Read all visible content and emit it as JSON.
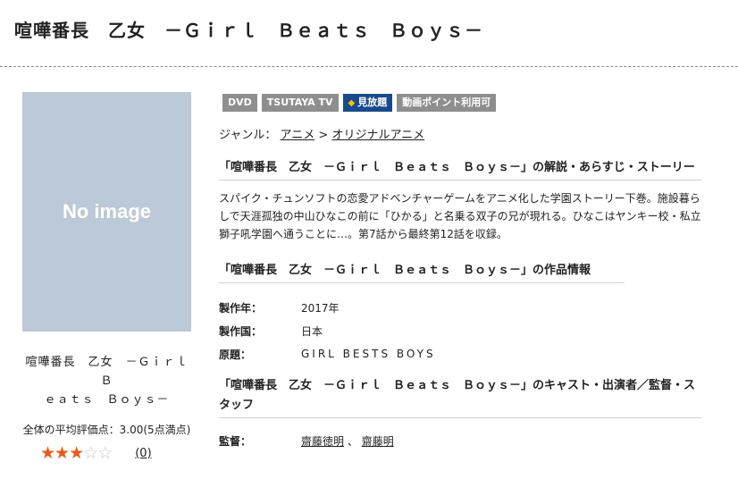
{
  "page": {
    "title": "喧嘩番長　乙女　－Ｇｉｒｌ　Ｂｅａｔｓ　Ｂｏｙｓ－"
  },
  "thumbnail": {
    "placeholder_text": "No image"
  },
  "sidebar": {
    "title_line1": "喧嘩番長　乙女　－Ｇｉｒｌ　Ｂ",
    "title_line2": "ｅａｔｓ　Ｂｏｙｓ－",
    "avg_rating_text": "全体の平均評価点：3.00(5点満点)",
    "stars_filled": 3,
    "stars_total": 5,
    "review_count": "(0)"
  },
  "badges": [
    {
      "label": "DVD",
      "icon": "none",
      "color": "#8e8e8e"
    },
    {
      "label": "TSUTAYA TV",
      "icon": "none",
      "color": "#8e8e8e"
    },
    {
      "label": "見放題",
      "icon": "t-logo-icon",
      "color": "#1a4a8c"
    },
    {
      "label": "動画ポイント利用可",
      "icon": "none",
      "color": "#8e8e8e"
    }
  ],
  "genre": {
    "label": "ジャンル：",
    "item1": "アニメ",
    "separator": ">",
    "item2": "オリジナルアニメ"
  },
  "synopsis": {
    "heading": "「喧嘩番長　乙女　－Ｇｉｒｌ　Ｂｅａｔｓ　Ｂｏｙｓ－」の解説・あらすじ・ストーリー",
    "text": "スパイク・チュンソフトの恋愛アドベンチャーゲームをアニメ化した学園ストーリー下巻。施設暮らしで天涯孤独の中山ひなこの前に「ひかる」と名乗る双子の兄が現れる。ひなこはヤンキー校・私立獅子吼学園へ通うことに…。第7話から最終第12話を収録。"
  },
  "work_info": {
    "heading": "「喧嘩番長　乙女　－Ｇｉｒｌ　Ｂｅａｔｓ　Ｂｏｙｓ－」の作品情報",
    "rows": [
      {
        "label": "製作年：",
        "value": "2017年"
      },
      {
        "label": "製作国：",
        "value": "日本"
      },
      {
        "label": "原題：",
        "value": "GIRL BESTS BOYS"
      }
    ]
  },
  "cast": {
    "heading": "「喧嘩番長　乙女　－Ｇｉｒｌ　Ｂｅａｔｓ　Ｂｏｙｓ－」のキャスト・出演者／監督・スタッフ",
    "director_label": "監督：",
    "director1": "齋藤徳明",
    "director_sep": "、",
    "director2": "齋藤明"
  }
}
